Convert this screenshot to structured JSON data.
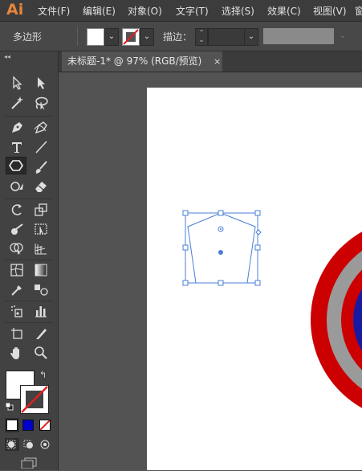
{
  "app": {
    "logo": "Ai"
  },
  "menu": [
    "文件(F)",
    "编辑(E)",
    "对象(O)",
    "文字(T)",
    "选择(S)",
    "效果(C)",
    "视图(V)",
    "窗"
  ],
  "control_bar": {
    "tool_name": "多边形",
    "stroke_label": "描边："
  },
  "document_tab": {
    "title": "未标题-1* @ 97% (RGB/预览)",
    "close": "×"
  },
  "toolbar": {
    "collapse": "◂◂",
    "tools": [
      "selection-tool",
      "direct-selection-tool",
      "magic-wand-tool",
      "lasso-tool",
      "pen-tool",
      "curvature-tool",
      "type-tool",
      "line-segment-tool",
      "polygon-tool",
      "paintbrush-tool",
      "shaper-tool",
      "eraser-tool",
      "rotate-tool",
      "scale-tool",
      "warp-tool",
      "free-transform-tool",
      "shape-builder-tool",
      "perspective-grid-tool",
      "mesh-tool",
      "gradient-tool",
      "eyedropper-tool",
      "blend-tool",
      "symbol-sprayer-tool",
      "column-graph-tool",
      "artboard-tool",
      "slice-tool",
      "hand-tool",
      "zoom-tool"
    ],
    "selected_tool": "polygon-tool"
  },
  "colors": {
    "fill": "#ffffff",
    "stroke_none_red": "#e02020",
    "selection_blue": "#4a7fd4",
    "target_red": "#cc0000",
    "target_gray": "#9a9a9a",
    "target_blue": "#1a1aa0",
    "color_mode_blue": "#0000cc"
  }
}
